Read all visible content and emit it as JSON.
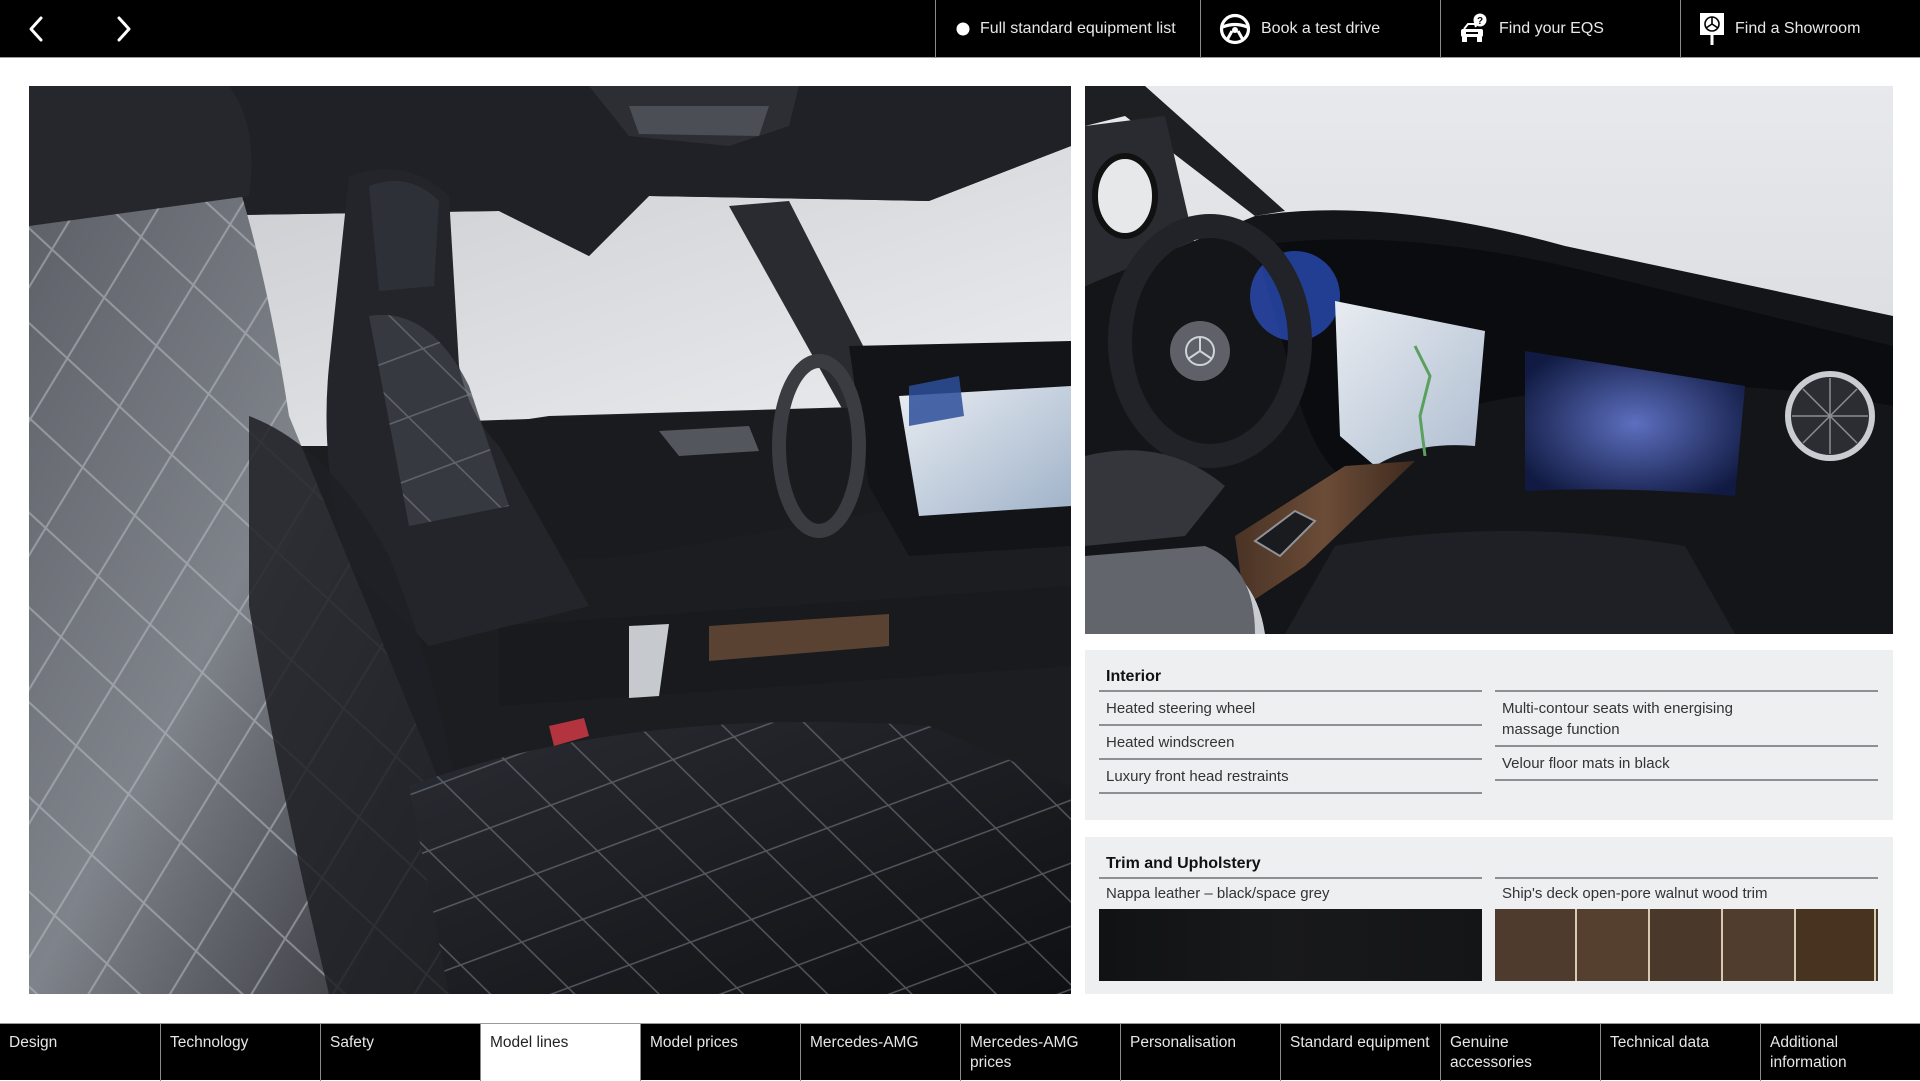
{
  "topbar": {
    "prev_label": "Previous page",
    "next_label": "Next page",
    "links": [
      {
        "label": "Full standard equipment list",
        "icon": "dot-icon"
      },
      {
        "label": "Book a test drive",
        "icon": "steering-wheel-icon"
      },
      {
        "label": "Find your EQS",
        "icon": "car-question-icon"
      },
      {
        "label": "Find a Showroom",
        "icon": "showroom-sign-icon"
      }
    ]
  },
  "photos": {
    "left_alt": "EQS interior – front seats in black/space grey Nappa leather with diamond quilting",
    "right_alt": "EQS dashboard with MBUX Hyperscreen, steering wheel and walnut wood trim"
  },
  "interior": {
    "title": "Interior",
    "left_items": [
      "Heated steering wheel",
      "Heated windscreen",
      "Luxury front head restraints"
    ],
    "right_items": [
      "Multi-contour seats with energising massage function",
      "Velour floor mats in black"
    ]
  },
  "trim": {
    "title": "Trim and Upholstery",
    "swatches": [
      {
        "label": "Nappa leather – black/space grey",
        "color": "#141517"
      },
      {
        "label": "Ship's deck open-pore walnut wood trim",
        "color": "#4b3a2c"
      }
    ]
  },
  "bottom_nav": {
    "active_index": 3,
    "items": [
      "Design",
      "Technology",
      "Safety",
      "Model lines",
      "Model prices",
      "Mercedes-AMG",
      "Mercedes-AMG prices",
      "Personalisation",
      "Standard equipment",
      "Genuine accessories",
      "Technical data",
      "Additional information"
    ]
  }
}
